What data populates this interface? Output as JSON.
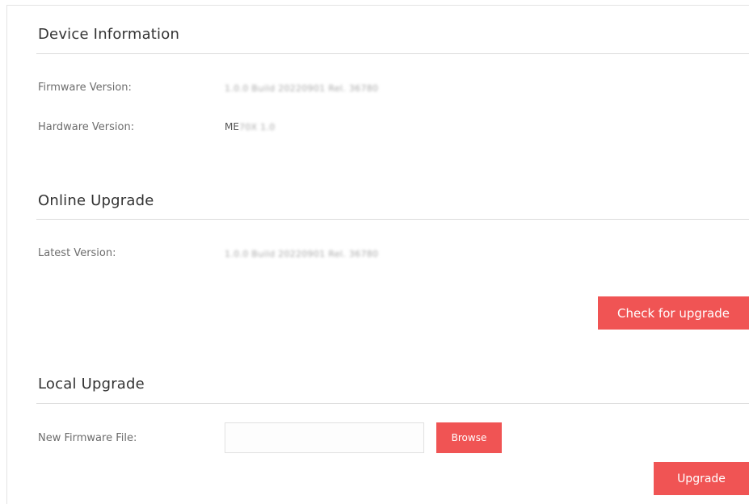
{
  "device_info": {
    "title": "Device Information",
    "firmware_label": "Firmware Version:",
    "firmware_value": "1.0.0 Build 20220901 Rel. 36780",
    "hardware_label": "Hardware Version:",
    "hardware_prefix": "ME",
    "hardware_value": "70X 1.0"
  },
  "online_upgrade": {
    "title": "Online Upgrade",
    "latest_label": "Latest Version:",
    "latest_value": "1.0.0 Build 20220901 Rel. 36780",
    "check_button": "Check for upgrade"
  },
  "local_upgrade": {
    "title": "Local Upgrade",
    "file_label": "New Firmware File:",
    "file_placeholder": "",
    "browse_button": "Browse",
    "upgrade_button": "Upgrade"
  },
  "colors": {
    "accent": "#f05454",
    "divider": "#dcdcdc",
    "title_text": "#333333",
    "label_text": "#6d6d6d"
  }
}
